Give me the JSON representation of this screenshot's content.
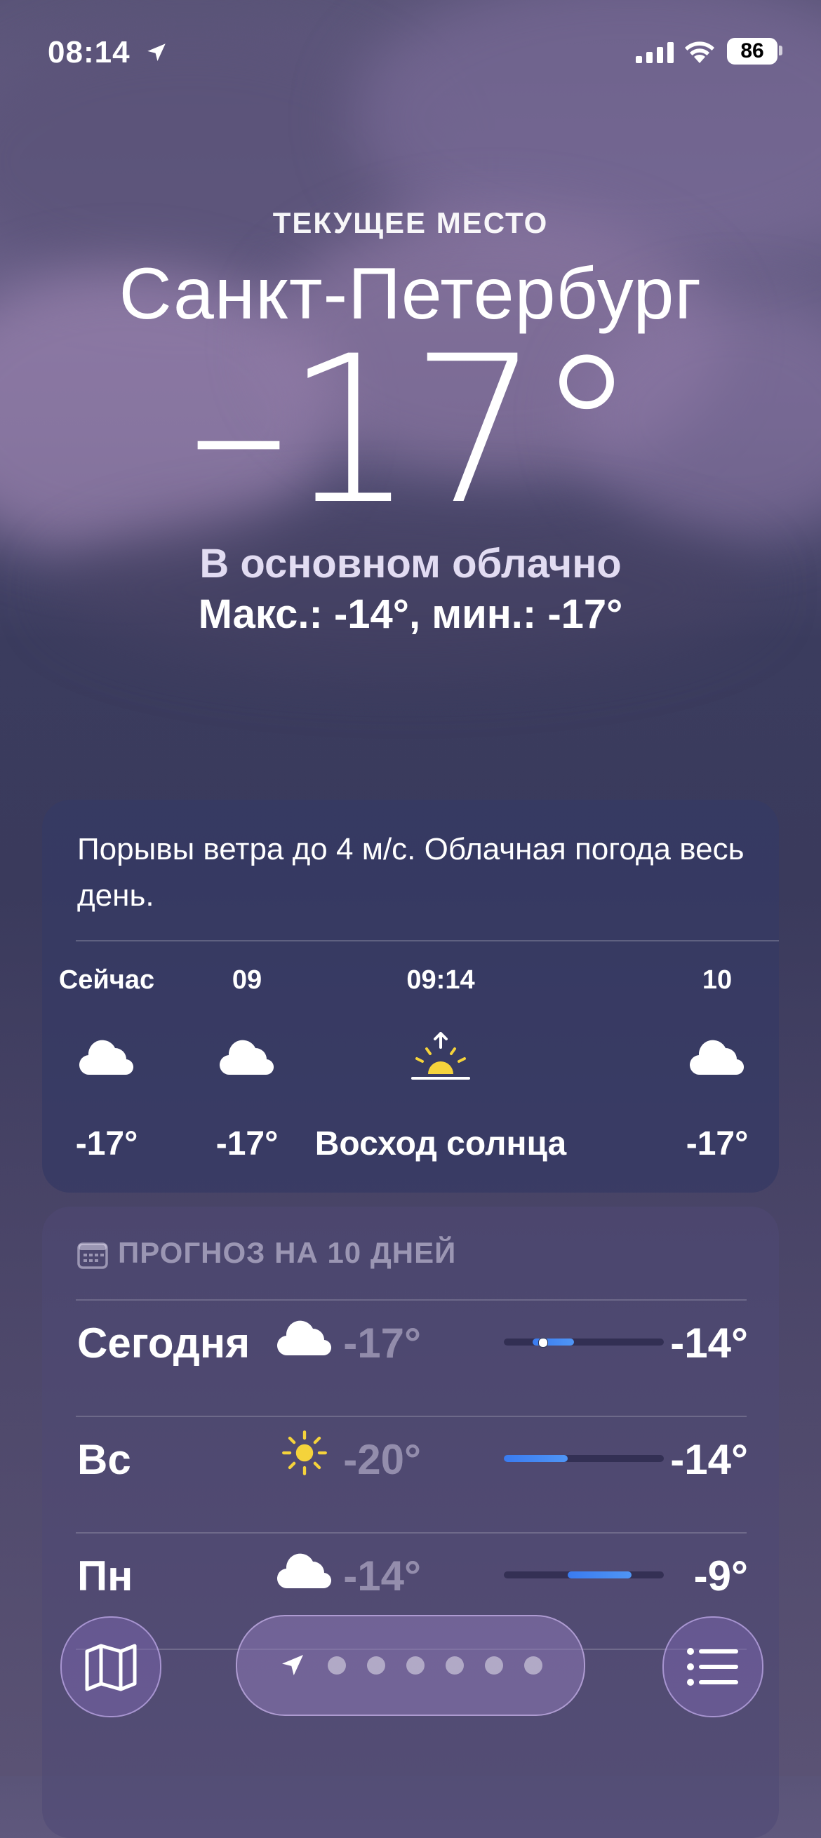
{
  "status_bar": {
    "time": "08:14",
    "battery": "86"
  },
  "header": {
    "place_label": "ТЕКУЩЕЕ МЕСТО",
    "city": "Санкт-Петербург",
    "temperature": "–17°",
    "condition": "В основном облачно",
    "hi_lo": "Макс.: -14°, мин.: -17°"
  },
  "hourly": {
    "summary": "Порывы ветра до 4 м/с. Облачная погода весь день.",
    "items": [
      {
        "label": "Сейчас",
        "icon": "cloud-icon",
        "value": "-17°"
      },
      {
        "label": "09",
        "icon": "cloud-icon",
        "value": "-17°"
      },
      {
        "label": "09:14",
        "icon": "sunrise-icon",
        "value": "Восход солнца"
      },
      {
        "label": "10",
        "icon": "cloud-icon",
        "value": "-17°"
      }
    ]
  },
  "daily": {
    "title": "ПРОГНОЗ НА 10 ДНЕЙ",
    "days": [
      {
        "name": "Сегодня",
        "icon": "cloud-icon",
        "low": "-17°",
        "high": "-14°",
        "range_start": 0.18,
        "range_end": 0.44,
        "current": 0.24
      },
      {
        "name": "Вс",
        "icon": "sun-icon",
        "low": "-20°",
        "high": "-14°",
        "range_start": 0.0,
        "range_end": 0.4
      },
      {
        "name": "Пн",
        "icon": "cloud-icon",
        "low": "-14°",
        "high": "-9°",
        "range_start": 0.4,
        "range_end": 0.8
      }
    ]
  },
  "toolbar": {
    "map_button": "map-icon",
    "list_button": "list-icon",
    "page_dots": 6
  },
  "colors": {
    "accent_bar": "#3a7bf0",
    "sun": "#f5d33b"
  }
}
